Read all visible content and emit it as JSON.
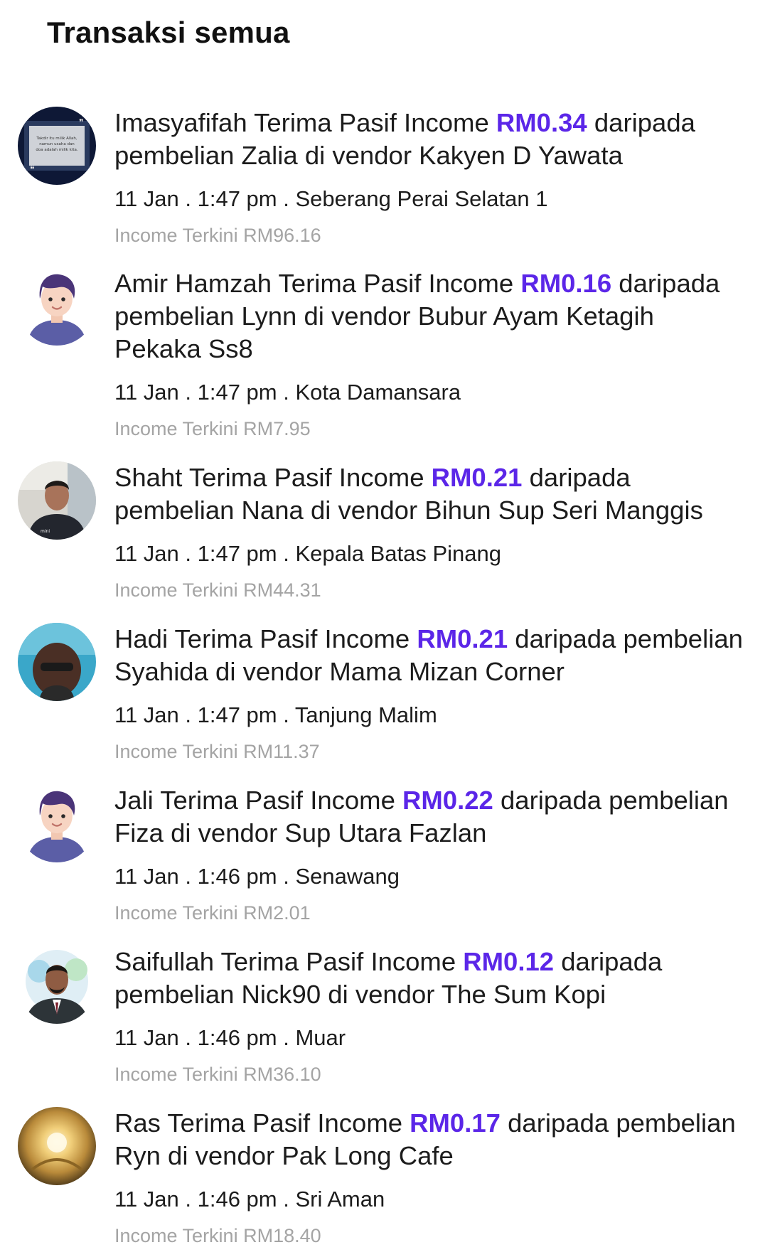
{
  "page": {
    "title": "Transaksi semua"
  },
  "colors": {
    "amount": "#5b26e8",
    "income_text": "#a4a4a4",
    "avatar_generic_bg": "#5b5ea6"
  },
  "transactions": [
    {
      "name": "Imasyafifah",
      "amount": "RM0.34",
      "message_before": "Imasyafifah Terima Pasif Income ",
      "message_after": " daripada pembelian Zalia  di vendor Kakyen D Yawata",
      "date": "11 Jan",
      "time": "1:47 pm",
      "location": "Seberang Perai Selatan 1",
      "meta": "11 Jan . 1:47 pm . Seberang Perai Selatan 1",
      "income": "Income Terkini RM96.16",
      "avatar_type": "quote-image",
      "avatar_text": "Takdir itu milik Allah, namun usaha dan doa adalah milik kita."
    },
    {
      "name": "Amir Hamzah",
      "amount": "RM0.16",
      "message_before": "Amir Hamzah Terima Pasif Income ",
      "message_after": " daripada pembelian Lynn di vendor Bubur Ayam Ketagih Pekaka Ss8",
      "date": "11 Jan",
      "time": "1:47 pm",
      "location": "Kota Damansara",
      "meta": "11 Jan . 1:47 pm . Kota Damansara",
      "income": "Income Terkini RM7.95",
      "avatar_type": "default-avatar"
    },
    {
      "name": "Shaht",
      "amount": "RM0.21",
      "message_before": "Shaht Terima Pasif Income ",
      "message_after": " daripada pembelian Nana di vendor Bihun Sup Seri Manggis",
      "date": "11 Jan",
      "time": "1:47 pm",
      "location": "Kepala Batas Pinang",
      "meta": "11 Jan . 1:47 pm . Kepala Batas Pinang",
      "income": "Income Terkini RM44.31",
      "avatar_type": "photo"
    },
    {
      "name": "Hadi",
      "amount": "RM0.21",
      "message_before": "Hadi Terima Pasif Income ",
      "message_after": " daripada pembelian Syahida di vendor Mama Mizan Corner",
      "date": "11 Jan",
      "time": "1:47 pm",
      "location": "Tanjung Malim",
      "meta": "11 Jan . 1:47 pm . Tanjung Malim",
      "income": "Income Terkini RM11.37",
      "avatar_type": "photo"
    },
    {
      "name": "Jali",
      "amount": "RM0.22",
      "message_before": "Jali Terima Pasif Income ",
      "message_after": " daripada pembelian Fiza di vendor Sup Utara Fazlan",
      "date": "11 Jan",
      "time": "1:46 pm",
      "location": "Senawang",
      "meta": "11 Jan . 1:46 pm . Senawang",
      "income": "Income Terkini RM2.01",
      "avatar_type": "default-avatar"
    },
    {
      "name": "Saifullah",
      "amount": "RM0.12",
      "message_before": "Saifullah Terima Pasif Income ",
      "message_after": " daripada pembelian Nick90 di vendor The Sum Kopi",
      "date": "11 Jan",
      "time": "1:46 pm",
      "location": "Muar",
      "meta": "11 Jan . 1:46 pm . Muar",
      "income": "Income Terkini RM36.10",
      "avatar_type": "photo"
    },
    {
      "name": "Ras",
      "amount": "RM0.17",
      "message_before": "Ras Terima Pasif Income ",
      "message_after": " daripada pembelian Ryn di vendor Pak Long Cafe",
      "date": "11 Jan",
      "time": "1:46 pm",
      "location": "Sri Aman",
      "meta": "11 Jan . 1:46 pm . Sri Aman",
      "income": "Income Terkini RM18.40",
      "avatar_type": "photo"
    }
  ]
}
